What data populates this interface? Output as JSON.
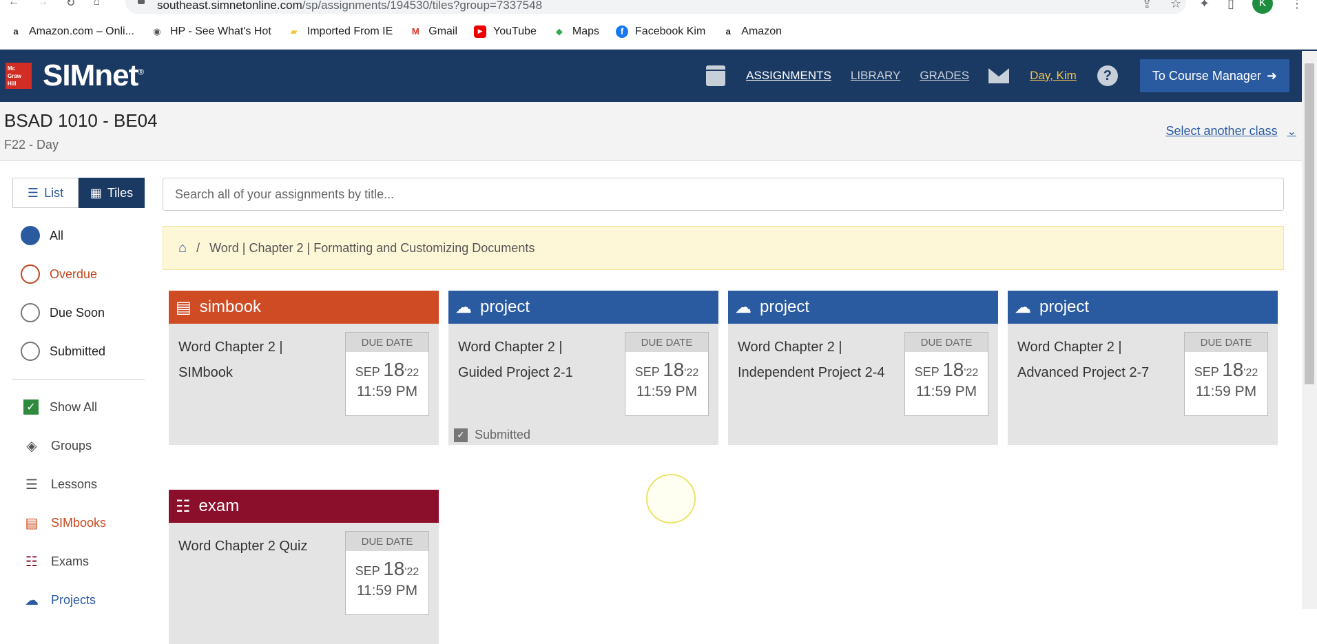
{
  "browser": {
    "url_host": "southeast.simnetonline.com",
    "url_path": "/sp/assignments/194530/tiles?group=7337548",
    "avatar_letter": "K",
    "bookmarks": [
      {
        "label": "Amazon.com – Onli...",
        "icon": "amazon-icon"
      },
      {
        "label": "HP - See What's Hot",
        "icon": "globe-icon"
      },
      {
        "label": "Imported From IE",
        "icon": "folder-icon"
      },
      {
        "label": "Gmail",
        "icon": "gmail-icon"
      },
      {
        "label": "YouTube",
        "icon": "youtube-icon"
      },
      {
        "label": "Maps",
        "icon": "maps-icon"
      },
      {
        "label": "Facebook Kim",
        "icon": "facebook-icon"
      },
      {
        "label": "Amazon",
        "icon": "amazon-icon"
      }
    ]
  },
  "header": {
    "logo_small": "Mc Graw Hill",
    "logo": "SIMnet",
    "nav": {
      "assignments": "ASSIGNMENTS",
      "library": "LIBRARY",
      "grades": "GRADES"
    },
    "user": "Day, Kim",
    "course_manager": "To Course Manager"
  },
  "class": {
    "title": "BSAD 1010 - BE04",
    "subtitle": "F22 - Day",
    "select_another": "Select another class"
  },
  "sidebar": {
    "view": {
      "list": "List",
      "tiles": "Tiles"
    },
    "filters": [
      "All",
      "Overdue",
      "Due Soon",
      "Submitted"
    ],
    "show_all": "Show All",
    "items": [
      "Groups",
      "Lessons",
      "SIMbooks",
      "Exams",
      "Projects"
    ]
  },
  "search": {
    "placeholder": "Search all of your assignments by title..."
  },
  "breadcrumb": {
    "separator": "/",
    "path": "Word | Chapter 2 | Formatting and Customizing Documents"
  },
  "tiles": [
    {
      "type": "simbook",
      "title": "Word Chapter 2 | SIMbook",
      "due_label": "DUE DATE",
      "month": "SEP",
      "day": "18",
      "year": "'22",
      "time": "11:59 PM",
      "status": ""
    },
    {
      "type": "project",
      "title": "Word Chapter 2 | Guided Project 2-1",
      "due_label": "DUE DATE",
      "month": "SEP",
      "day": "18",
      "year": "'22",
      "time": "11:59 PM",
      "status": "Submitted"
    },
    {
      "type": "project",
      "title": "Word Chapter 2 | Independent Project 2-4",
      "due_label": "DUE DATE",
      "month": "SEP",
      "day": "18",
      "year": "'22",
      "time": "11:59 PM",
      "status": ""
    },
    {
      "type": "project",
      "title": "Word Chapter 2 | Advanced Project 2-7",
      "due_label": "DUE DATE",
      "month": "SEP",
      "day": "18",
      "year": "'22",
      "time": "11:59 PM",
      "status": ""
    },
    {
      "type": "exam",
      "title": "Word Chapter 2 Quiz",
      "due_label": "DUE DATE",
      "month": "SEP",
      "day": "18",
      "year": "'22",
      "time": "11:59 PM",
      "status": ""
    }
  ],
  "colors": {
    "header": "#1b3a63",
    "simbook": "#cf4b24",
    "project": "#2a5aa0",
    "exam": "#8b0f2b"
  }
}
